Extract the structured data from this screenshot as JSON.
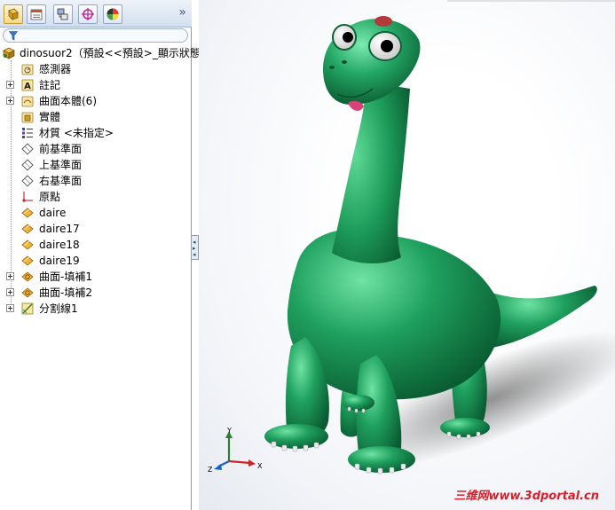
{
  "feature_tree": {
    "root": "dinosuor2（預設<<預設>_顯示狀態",
    "items": [
      {
        "label": "感測器",
        "icon": "sensor-folder-icon",
        "expandable": false
      },
      {
        "label": "註記",
        "icon": "annotation-icon",
        "expandable": true
      },
      {
        "label": "曲面本體(6)",
        "icon": "surface-bodies-folder-icon",
        "expandable": true
      },
      {
        "label": "實體",
        "icon": "solid-bodies-folder-icon",
        "expandable": false
      },
      {
        "label": "材質 <未指定>",
        "icon": "material-icon",
        "expandable": false
      },
      {
        "label": "前基準面",
        "icon": "plane-icon",
        "expandable": false
      },
      {
        "label": "上基準面",
        "icon": "plane-icon",
        "expandable": false
      },
      {
        "label": "右基準面",
        "icon": "plane-icon",
        "expandable": false
      },
      {
        "label": "原點",
        "icon": "origin-icon",
        "expandable": false
      },
      {
        "label": "daire",
        "icon": "sketch-icon",
        "expandable": false
      },
      {
        "label": "daire17",
        "icon": "sketch-icon",
        "expandable": false
      },
      {
        "label": "daire18",
        "icon": "sketch-icon",
        "expandable": false
      },
      {
        "label": "daire19",
        "icon": "sketch-icon",
        "expandable": false
      },
      {
        "label": "曲面-填補1",
        "icon": "surface-fill-icon",
        "expandable": true
      },
      {
        "label": "曲面-填補2",
        "icon": "surface-fill-icon",
        "expandable": true
      },
      {
        "label": "分割線1",
        "icon": "split-line-icon",
        "expandable": true
      }
    ]
  },
  "tabs": [
    "feature-manager",
    "property-manager",
    "configuration-manager",
    "dimxpert-manager",
    "display-manager"
  ],
  "triad": {
    "x": "X",
    "y": "Y",
    "z": "Z"
  },
  "watermark": "三维网www.3dportal.cn",
  "colors": {
    "dino_green": "#1fa05e",
    "dino_dark": "#0a5c32",
    "panel_header": "#d3dfee",
    "watermark_red": "#d81e2a"
  }
}
